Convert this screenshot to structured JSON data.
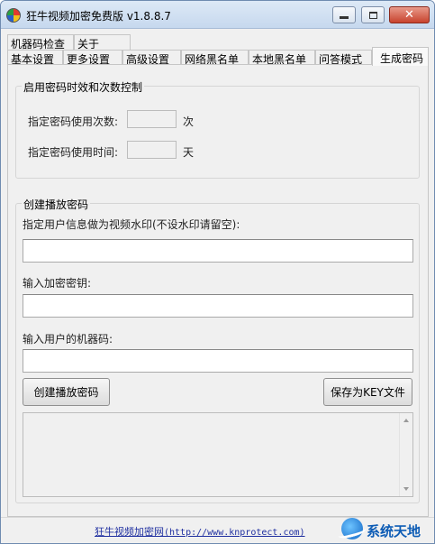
{
  "window": {
    "title": "狂牛视频加密免费版 v1.8.8.7",
    "close_glyph": "✕"
  },
  "tabs_row1": [
    "机器码检查",
    "关于"
  ],
  "tabs_row2": [
    "基本设置",
    "更多设置",
    "高级设置",
    "网络黑名单",
    "本地黑名单",
    "问答模式",
    "生成密码"
  ],
  "active_tab": "生成密码",
  "expiry_group": {
    "title": "启用密码时效和次数控制",
    "count_label": "指定密码使用次数:",
    "count_value": "",
    "count_unit": "次",
    "time_label": "指定密码使用时间:",
    "time_value": "",
    "time_unit": "天"
  },
  "create_group": {
    "title": "创建播放密码",
    "user_info_label": "指定用户信息做为视频水印(不设水印请留空):",
    "user_info_value": "",
    "key_label": "输入加密密钥:",
    "key_value": "",
    "machine_code_label": "输入用户的机器码:",
    "machine_code_value": "",
    "create_button": "创建播放密码",
    "save_button": "保存为KEY文件",
    "output_value": ""
  },
  "footer": {
    "link_text": "狂牛视频加密网",
    "link_url": "(http://www.knprotect.com)",
    "watermark": "系统天地"
  },
  "colors": {
    "titlebar": "#c6d8ee",
    "link": "#1f2fa0",
    "watermark": "#0d5cb5",
    "close_button": "#c8432e"
  }
}
